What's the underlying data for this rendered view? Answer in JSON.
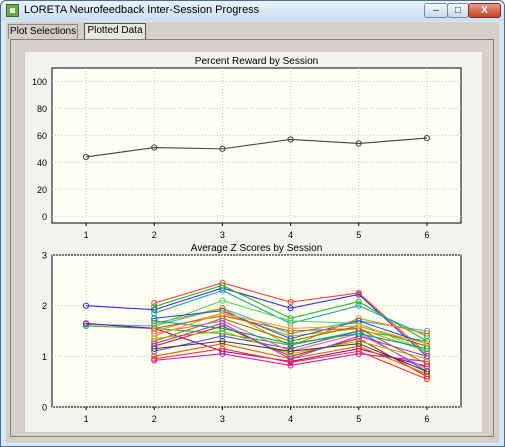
{
  "window": {
    "title": "LORETA Neurofeedback Inter-Session Progress",
    "buttons": {
      "minimize": "–",
      "maximize": "□",
      "close": "X"
    }
  },
  "tabs": [
    {
      "label": "Plot Selections",
      "active": false
    },
    {
      "label": "Plotted Data",
      "active": true
    }
  ],
  "colors": {
    "plot_bg": "#fffff4",
    "grid": "#c8c8c8",
    "reward_line": "#404040"
  },
  "chart_data": [
    {
      "type": "line",
      "title": "Percent Reward by Session",
      "xlabel": "",
      "ylabel": "",
      "x": [
        1,
        2,
        3,
        4,
        5,
        6
      ],
      "xlim": [
        0.5,
        6.5
      ],
      "ylim": [
        -5,
        110
      ],
      "yticks": [
        0,
        20,
        40,
        60,
        80,
        100
      ],
      "grid": true,
      "series": [
        {
          "values": [
            44,
            51,
            50,
            57,
            54,
            58
          ],
          "color": "#404040"
        }
      ]
    },
    {
      "type": "line",
      "title": "Average Z Scores by Session",
      "xlabel": "",
      "ylabel": "",
      "x": [
        1,
        2,
        3,
        4,
        5,
        6
      ],
      "xlim": [
        0.5,
        6.5
      ],
      "ylim": [
        0,
        3
      ],
      "yticks": [
        0,
        1,
        2,
        3
      ],
      "grid": true,
      "series": [
        {
          "values": [
            2.0,
            1.92,
            2.35,
            1.95,
            2.22,
            1.0
          ],
          "color": "#3030e0"
        },
        {
          "values": [
            null,
            2.05,
            2.45,
            2.07,
            2.25,
            1.05
          ],
          "color": "#f04040"
        },
        {
          "values": [
            1.63,
            1.6,
            1.95,
            1.45,
            1.7,
            1.5
          ],
          "color": "#40b0d0"
        },
        {
          "values": [
            1.6,
            1.55,
            1.45,
            1.22,
            1.5,
            1.3
          ],
          "color": "#30b030"
        },
        {
          "values": [
            1.65,
            1.55,
            1.1,
            0.9,
            1.15,
            0.8
          ],
          "color": "#a000a0"
        },
        {
          "values": [
            null,
            1.98,
            2.4,
            1.75,
            2.08,
            1.3
          ],
          "color": "#30b030"
        },
        {
          "values": [
            null,
            1.85,
            2.3,
            1.65,
            2.0,
            1.4
          ],
          "color": "#20a0a0"
        },
        {
          "values": [
            null,
            1.65,
            1.95,
            1.2,
            1.75,
            1.45
          ],
          "color": "#f08000"
        },
        {
          "values": [
            null,
            1.5,
            1.85,
            1.4,
            1.55,
            1.1
          ],
          "color": "#d0a000"
        },
        {
          "values": [
            null,
            1.2,
            1.6,
            1.0,
            1.35,
            0.6
          ],
          "color": "#e02020"
        },
        {
          "values": [
            null,
            0.92,
            1.05,
            0.82,
            1.05,
            0.9
          ],
          "color": "#c020c0"
        },
        {
          "values": [
            null,
            1.1,
            1.4,
            1.15,
            1.5,
            0.7
          ],
          "color": "#5050f0"
        },
        {
          "values": [
            null,
            1.3,
            1.75,
            1.3,
            1.6,
            1.2
          ],
          "color": "#808000"
        },
        {
          "values": [
            null,
            1.45,
            1.7,
            1.1,
            1.45,
            0.75
          ],
          "color": "#ff60a0"
        },
        {
          "values": [
            null,
            1.6,
            2.1,
            1.7,
            1.65,
            1.1
          ],
          "color": "#60d060"
        },
        {
          "values": [
            null,
            1.0,
            1.25,
            0.95,
            1.2,
            0.65
          ],
          "color": "#e06000"
        },
        {
          "values": [
            null,
            1.75,
            1.9,
            1.35,
            1.7,
            1.25
          ],
          "color": "#2060c0"
        },
        {
          "values": [
            null,
            1.35,
            1.5,
            1.05,
            1.3,
            0.95
          ],
          "color": "#b0b000"
        },
        {
          "values": [
            null,
            1.55,
            1.8,
            1.5,
            1.55,
            0.85
          ],
          "color": "#c06030"
        },
        {
          "values": [
            null,
            1.25,
            1.65,
            0.95,
            1.4,
            1.0
          ],
          "color": "#9040e0"
        },
        {
          "values": [
            null,
            1.7,
            1.55,
            1.25,
            1.45,
            1.15
          ],
          "color": "#00a070"
        },
        {
          "values": [
            null,
            0.95,
            1.15,
            0.88,
            1.1,
            0.55
          ],
          "color": "#ff3030"
        },
        {
          "values": [
            null,
            1.4,
            1.85,
            1.55,
            1.6,
            1.25
          ],
          "color": "#ffa030"
        },
        {
          "values": [
            null,
            1.15,
            1.3,
            1.1,
            1.25,
            0.7
          ],
          "color": "#404040"
        }
      ]
    }
  ]
}
